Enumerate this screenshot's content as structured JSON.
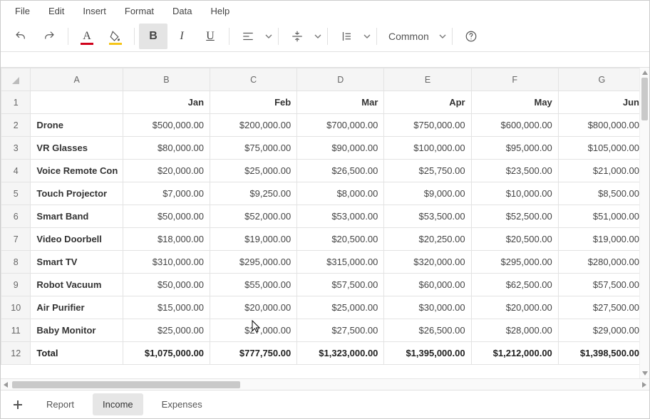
{
  "menu": {
    "items": [
      "File",
      "Edit",
      "Insert",
      "Format",
      "Data",
      "Help"
    ]
  },
  "toolbar": {
    "font_color": "#d0021b",
    "fill_color": "#f5c518",
    "font_name": "Common"
  },
  "sheet": {
    "columns": [
      "A",
      "B",
      "C",
      "D",
      "E",
      "F",
      "G"
    ],
    "months": [
      "Jan",
      "Feb",
      "Mar",
      "Apr",
      "May",
      "Jun"
    ],
    "rows": [
      {
        "label": "Drone",
        "vals": [
          "$500,000.00",
          "$200,000.00",
          "$700,000.00",
          "$750,000.00",
          "$600,000.00",
          "$800,000.00"
        ]
      },
      {
        "label": "VR Glasses",
        "vals": [
          "$80,000.00",
          "$75,000.00",
          "$90,000.00",
          "$100,000.00",
          "$95,000.00",
          "$105,000.00"
        ]
      },
      {
        "label": "Voice Remote Con",
        "vals": [
          "$20,000.00",
          "$25,000.00",
          "$26,500.00",
          "$25,750.00",
          "$23,500.00",
          "$21,000.00"
        ]
      },
      {
        "label": "Touch Projector",
        "vals": [
          "$7,000.00",
          "$9,250.00",
          "$8,000.00",
          "$9,000.00",
          "$10,000.00",
          "$8,500.00"
        ]
      },
      {
        "label": "Smart Band",
        "vals": [
          "$50,000.00",
          "$52,000.00",
          "$53,000.00",
          "$53,500.00",
          "$52,500.00",
          "$51,000.00"
        ]
      },
      {
        "label": "Video Doorbell",
        "vals": [
          "$18,000.00",
          "$19,000.00",
          "$20,500.00",
          "$20,250.00",
          "$20,500.00",
          "$19,000.00"
        ]
      },
      {
        "label": "Smart TV",
        "vals": [
          "$310,000.00",
          "$295,000.00",
          "$315,000.00",
          "$320,000.00",
          "$295,000.00",
          "$280,000.00"
        ]
      },
      {
        "label": "Robot Vacuum",
        "vals": [
          "$50,000.00",
          "$55,000.00",
          "$57,500.00",
          "$60,000.00",
          "$62,500.00",
          "$57,500.00"
        ]
      },
      {
        "label": "Air Purifier",
        "vals": [
          "$15,000.00",
          "$20,000.00",
          "$25,000.00",
          "$30,000.00",
          "$20,000.00",
          "$27,500.00"
        ]
      },
      {
        "label": "Baby Monitor",
        "vals": [
          "$25,000.00",
          "$27,000.00",
          "$27,500.00",
          "$26,500.00",
          "$28,000.00",
          "$29,000.00"
        ]
      }
    ],
    "total": {
      "label": "Total",
      "vals": [
        "$1,075,000.00",
        "$777,750.00",
        "$1,323,000.00",
        "$1,395,000.00",
        "$1,212,000.00",
        "$1,398,500.00"
      ]
    }
  },
  "tabs": {
    "items": [
      "Report",
      "Income",
      "Expenses"
    ],
    "active": 1
  }
}
